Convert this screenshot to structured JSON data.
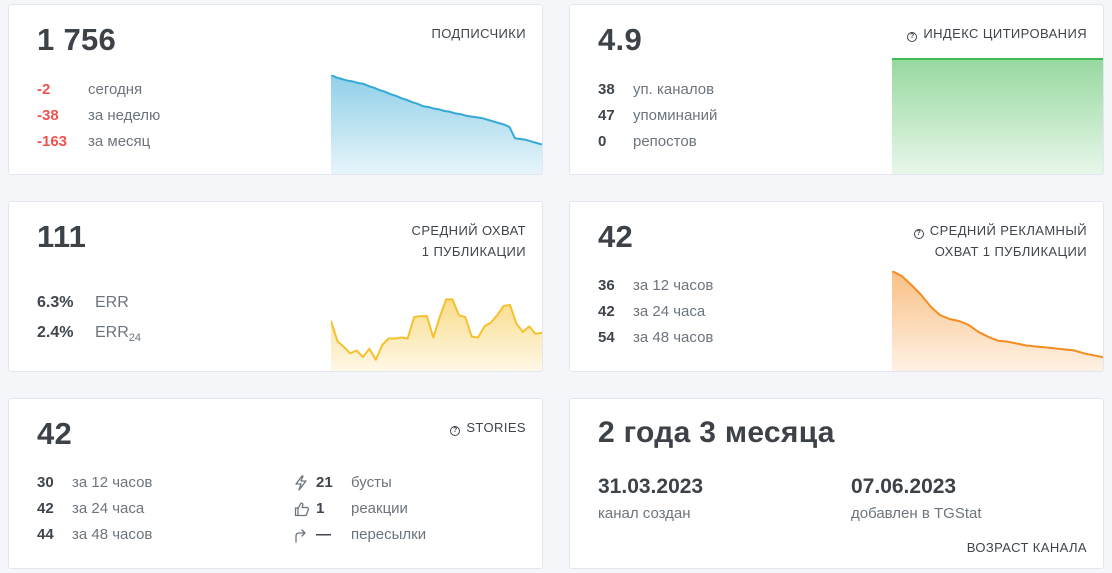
{
  "subscribers": {
    "value": "1 756",
    "label": "ПОДПИСЧИКИ",
    "rows": [
      {
        "num": "-2",
        "text": "сегодня"
      },
      {
        "num": "-38",
        "text": "за неделю"
      },
      {
        "num": "-163",
        "text": "за месяц"
      }
    ],
    "color": "#35a9d6"
  },
  "citation": {
    "value": "4.9",
    "label": "ИНДЕКС ЦИТИРОВАНИЯ",
    "rows": [
      {
        "num": "38",
        "text": "уп. каналов"
      },
      {
        "num": "47",
        "text": "упоминаний"
      },
      {
        "num": "0",
        "text": "репостов"
      }
    ],
    "color": "#40b950"
  },
  "reach": {
    "value": "111",
    "label_line1": "СРЕДНИЙ ОХВАТ",
    "label_line2": "1 ПУБЛИКАЦИИ",
    "rows": [
      {
        "num": "6.3%",
        "text": "ERR",
        "sub": ""
      },
      {
        "num": "2.4%",
        "text": "ERR",
        "sub": "24"
      }
    ],
    "color": "#f5c12e"
  },
  "ad_reach": {
    "value": "42",
    "label_line1": "СРЕДНИЙ РЕКЛАМНЫЙ",
    "label_line2": "ОХВАТ 1 ПУБЛИКАЦИИ",
    "rows": [
      {
        "num": "36",
        "text": "за 12 часов"
      },
      {
        "num": "42",
        "text": "за 24 часа"
      },
      {
        "num": "54",
        "text": "за 48 часов"
      }
    ],
    "color": "#f58c20"
  },
  "stories": {
    "value": "42",
    "label": "STORIES",
    "rows": [
      {
        "num": "30",
        "text": "за 12 часов"
      },
      {
        "num": "42",
        "text": "за 24 часа"
      },
      {
        "num": "44",
        "text": "за 48 часов"
      }
    ],
    "stats": [
      {
        "icon": "lightning-icon",
        "num": "21",
        "text": "бусты"
      },
      {
        "icon": "thumbs-up-icon",
        "num": "1",
        "text": "реакции"
      },
      {
        "icon": "share-arrow-icon",
        "num": "—",
        "text": "пересылки"
      }
    ]
  },
  "age": {
    "value": "2 года 3 месяца",
    "created_date": "31.03.2023",
    "created_label": "канал создан",
    "added_date": "07.06.2023",
    "added_label": "добавлен в TGStat",
    "label": "ВОЗРАСТ КАНАЛА"
  },
  "chart_data": [
    {
      "type": "area",
      "name": "subscribers-trend",
      "y": [
        100,
        97,
        95,
        93,
        92,
        90,
        89,
        86,
        84,
        81,
        79,
        76,
        74,
        71,
        69,
        66,
        64,
        61,
        60,
        58,
        57,
        55,
        54,
        52,
        51,
        49,
        48,
        47,
        46,
        44,
        42,
        40,
        38,
        35,
        21,
        20,
        19,
        17,
        15,
        13
      ],
      "ylim": [
        0,
        100
      ]
    },
    {
      "type": "area",
      "name": "citation-trend",
      "y": [
        100,
        100,
        100,
        100,
        100,
        100,
        100,
        100,
        100,
        100
      ],
      "ylim": [
        0,
        100
      ]
    },
    {
      "type": "area",
      "name": "reach-trend",
      "y": [
        54,
        32,
        26,
        19,
        22,
        15,
        24,
        12,
        28,
        35,
        35,
        36,
        35,
        58,
        59,
        59,
        36,
        58,
        77,
        77,
        60,
        58,
        37,
        36,
        48,
        52,
        60,
        70,
        71,
        51,
        42,
        48,
        40,
        41
      ],
      "ylim": [
        0,
        100
      ]
    },
    {
      "type": "area",
      "name": "ad-reach-trend",
      "y": [
        100,
        95,
        86,
        76,
        64,
        55,
        51,
        49,
        45,
        38,
        33,
        29,
        28,
        26,
        24,
        23,
        22,
        21,
        20,
        19,
        16,
        14,
        12
      ],
      "ylim": [
        0,
        100
      ]
    }
  ]
}
